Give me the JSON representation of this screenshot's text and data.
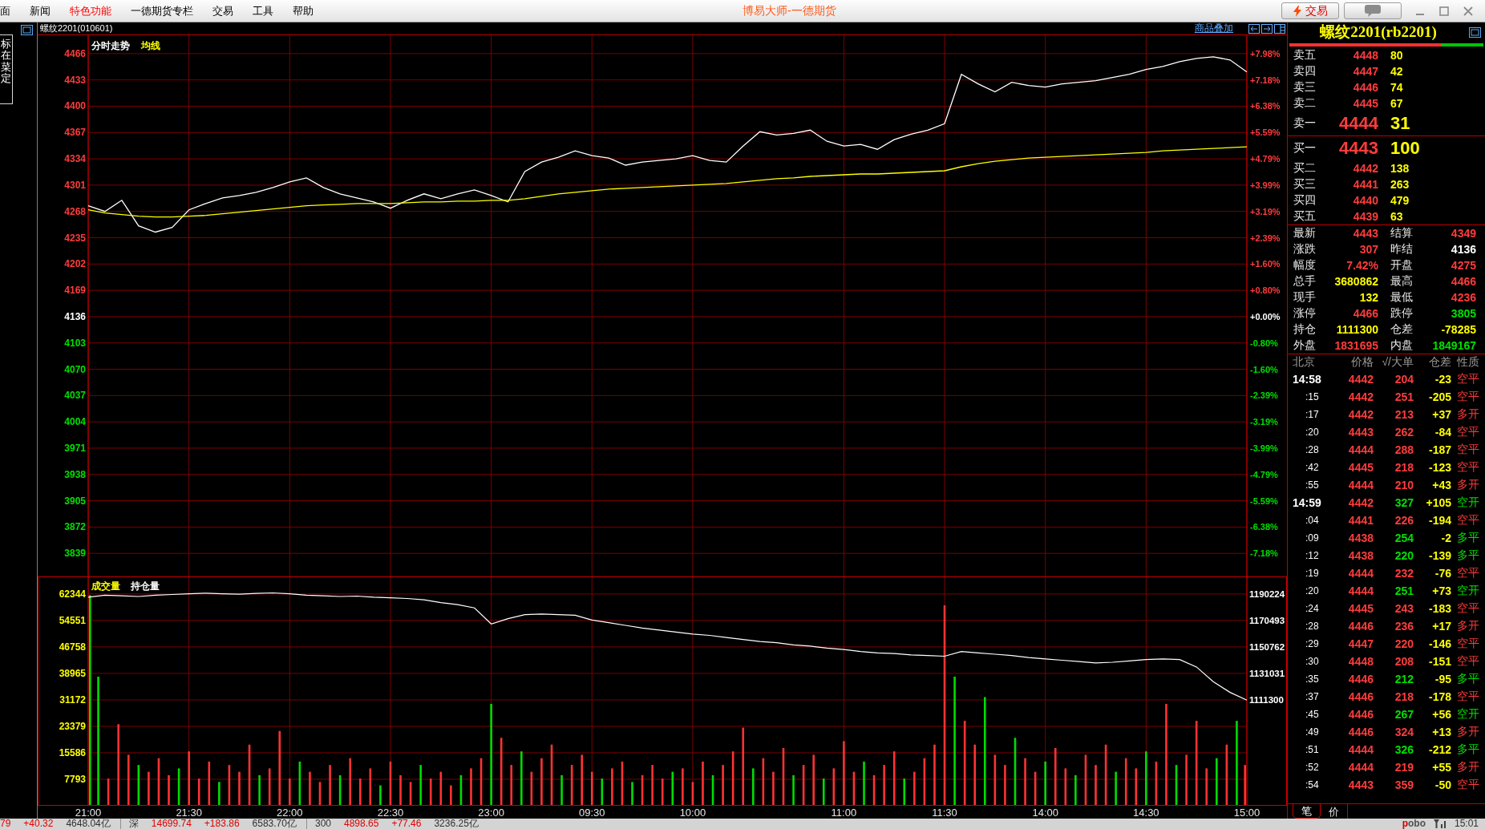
{
  "menu_bar": {
    "items": [
      {
        "label": "面",
        "highlighted": false
      },
      {
        "label": "新闻",
        "highlighted": false
      },
      {
        "label": "特色功能",
        "highlighted": true
      },
      {
        "label": "一德期货专栏",
        "highlighted": false
      },
      {
        "label": "交易",
        "highlighted": false
      },
      {
        "label": "工具",
        "highlighted": false
      },
      {
        "label": "帮助",
        "highlighted": false
      }
    ],
    "title": "博易大师-一德期货",
    "trade_button": {
      "label": "交易"
    }
  },
  "side_tab": {
    "label": "标在菜定"
  },
  "chart_header": {
    "symbol": "螺纹2201(010601)",
    "overlay_link": "商品叠加"
  },
  "price_chart": {
    "percent_axis": [
      {
        "label": "+7.98%",
        "color": "#ff3c3c"
      },
      {
        "label": "+7.18%",
        "color": "#ff3c3c"
      },
      {
        "label": "+6.38%",
        "color": "#ff3c3c"
      },
      {
        "label": "+5.59%",
        "color": "#ff3c3c"
      },
      {
        "label": "+4.79%",
        "color": "#ff3c3c"
      },
      {
        "label": "+3.99%",
        "color": "#ff3c3c"
      },
      {
        "label": "+3.19%",
        "color": "#ff3c3c"
      },
      {
        "label": "+2.39%",
        "color": "#ff3c3c"
      },
      {
        "label": "+1.60%",
        "color": "#ff3c3c"
      },
      {
        "label": "+0.80%",
        "color": "#ff3c3c"
      },
      {
        "label": "+0.00%",
        "color": "#ffffff"
      },
      {
        "label": "-0.80%",
        "color": "#00e000"
      },
      {
        "label": "-1.60%",
        "color": "#00e000"
      },
      {
        "label": "-2.39%",
        "color": "#00e000"
      },
      {
        "label": "-3.19%",
        "color": "#00e000"
      },
      {
        "label": "-3.99%",
        "color": "#00e000"
      },
      {
        "label": "-4.79%",
        "color": "#00e000"
      },
      {
        "label": "-5.59%",
        "color": "#00e000"
      },
      {
        "label": "-6.38%",
        "color": "#00e000"
      },
      {
        "label": "-7.18%",
        "color": "#00e000"
      }
    ],
    "chart_data": {
      "type": "line",
      "categories": [
        null,
        null,
        null,
        null,
        null,
        null,
        null,
        null,
        null,
        null,
        null,
        null,
        null,
        null,
        null,
        null,
        null,
        null,
        null,
        null,
        null,
        null,
        null,
        null,
        null,
        null,
        null,
        null,
        null,
        null,
        null,
        null,
        null,
        null,
        null,
        null,
        null,
        null,
        null,
        null,
        null,
        null,
        null,
        null,
        null,
        null,
        null,
        null,
        null,
        null,
        null,
        null,
        null,
        null,
        null,
        null,
        null,
        null,
        null,
        null,
        null,
        null,
        null,
        null,
        null,
        null,
        null,
        null,
        null,
        null
      ],
      "series": [
        {
          "name": "分时走势",
          "color": "#ffffff",
          "values": [
            4275,
            4268,
            4282,
            4250,
            4242,
            4248,
            4270,
            4278,
            4285,
            4288,
            4292,
            4298,
            4305,
            4310,
            4298,
            4290,
            4285,
            4280,
            4272,
            4282,
            4290,
            4284,
            4290,
            4295,
            4288,
            4280,
            4318,
            4330,
            4336,
            4344,
            4338,
            4335,
            4326,
            4330,
            4332,
            4334,
            4338,
            4332,
            4330,
            4350,
            4368,
            4364,
            4366,
            4370,
            4356,
            4350,
            4352,
            4346,
            4358,
            4365,
            4370,
            4378,
            4440,
            4428,
            4418,
            4430,
            4426,
            4424,
            4428,
            4430,
            4432,
            4436,
            4440,
            4446,
            4450,
            4456,
            4460,
            4462,
            4458,
            4443
          ]
        },
        {
          "name": "均线",
          "color": "#ffff00",
          "values": [
            4270,
            4266,
            4264,
            4262,
            4261,
            4261,
            4262,
            4263,
            4265,
            4267,
            4269,
            4271,
            4273,
            4275,
            4276,
            4277,
            4278,
            4278,
            4278,
            4279,
            4280,
            4280,
            4281,
            4281,
            4282,
            4282,
            4284,
            4287,
            4290,
            4292,
            4294,
            4296,
            4297,
            4298,
            4299,
            4300,
            4301,
            4302,
            4303,
            4305,
            4307,
            4309,
            4310,
            4312,
            4313,
            4314,
            4315,
            4315,
            4316,
            4317,
            4318,
            4319,
            4324,
            4328,
            4331,
            4333,
            4335,
            4336,
            4337,
            4338,
            4339,
            4340,
            4341,
            4342,
            4344,
            4345,
            4346,
            4347,
            4348,
            4349
          ]
        }
      ],
      "ylim": [
        3810,
        4489
      ],
      "yticks": [
        4466,
        4433,
        4400,
        4367,
        4334,
        4301,
        4268,
        4235,
        4202,
        4169,
        4136,
        4103,
        4070,
        4037,
        4004,
        3971,
        3938,
        3905,
        3872,
        3839
      ],
      "grid": true
    }
  },
  "volume_chart": {
    "legend": [
      {
        "label": "成交量",
        "color": "#ffff00"
      }
    ],
    "chart_data": {
      "type": "bar",
      "categories": [
        "21:00",
        null,
        null,
        null,
        null,
        null,
        null,
        null,
        null,
        null,
        "21:30",
        null,
        null,
        null,
        null,
        null,
        null,
        null,
        null,
        null,
        "22:00",
        null,
        null,
        null,
        null,
        null,
        null,
        null,
        null,
        null,
        "22:30",
        null,
        null,
        null,
        null,
        null,
        null,
        null,
        null,
        null,
        "23:00",
        null,
        null,
        null,
        null,
        null,
        null,
        null,
        null,
        null,
        "09:30",
        null,
        null,
        null,
        null,
        null,
        null,
        null,
        null,
        null,
        "10:00",
        null,
        null,
        null,
        null,
        null,
        null,
        null,
        null,
        null,
        null,
        null,
        null,
        null,
        null,
        "11:00",
        null,
        null,
        null,
        null,
        null,
        null,
        null,
        null,
        null,
        "11:30",
        null,
        null,
        null,
        null,
        null,
        null,
        null,
        null,
        null,
        "14:00",
        null,
        null,
        null,
        null,
        null,
        null,
        null,
        null,
        null,
        "14:30",
        null,
        null,
        null,
        null,
        null,
        null,
        null,
        null,
        null,
        "15:00"
      ],
      "series": [
        {
          "color": "#ff3232",
          "values": [
            null,
            null,
            8000,
            24000,
            15000,
            null,
            10000,
            14000,
            9000,
            null,
            16000,
            8000,
            13000,
            null,
            12000,
            10000,
            18000,
            null,
            11000,
            22000,
            8000,
            null,
            10000,
            7000,
            12000,
            null,
            14000,
            8000,
            11000,
            null,
            13000,
            9000,
            7000,
            null,
            8000,
            10000,
            6000,
            null,
            11000,
            14000,
            null,
            20000,
            12000,
            null,
            10000,
            14000,
            18000,
            null,
            12000,
            15000,
            10000,
            null,
            11000,
            13000,
            null,
            9000,
            12000,
            8000,
            null,
            11000,
            7000,
            13000,
            null,
            12000,
            16000,
            23000,
            null,
            14000,
            10000,
            17000,
            null,
            12000,
            15000,
            null,
            11000,
            19000,
            10000,
            null,
            9000,
            12000,
            16000,
            null,
            10000,
            14000,
            18000,
            59000,
            null,
            25000,
            18000,
            null,
            15000,
            12000,
            null,
            14000,
            10000,
            null,
            17000,
            11000,
            null,
            15000,
            12000,
            18000,
            null,
            14000,
            11000,
            null,
            13000,
            30000,
            null,
            15000,
            25000,
            11000,
            null,
            18000,
            null,
            12000
          ]
        },
        {
          "color": "#00dc00",
          "values": [
            62000,
            38000,
            null,
            null,
            null,
            12000,
            null,
            null,
            null,
            11000,
            null,
            null,
            null,
            7000,
            null,
            null,
            null,
            9000,
            null,
            null,
            null,
            13000,
            null,
            null,
            null,
            9000,
            null,
            null,
            null,
            6000,
            null,
            null,
            null,
            12000,
            null,
            null,
            null,
            9000,
            null,
            null,
            30000,
            null,
            null,
            16000,
            null,
            null,
            null,
            9000,
            null,
            null,
            null,
            8000,
            null,
            null,
            7000,
            null,
            null,
            null,
            10000,
            null,
            null,
            null,
            9000,
            null,
            null,
            null,
            11000,
            null,
            null,
            null,
            9000,
            null,
            null,
            8000,
            null,
            null,
            null,
            13000,
            null,
            null,
            null,
            8000,
            null,
            null,
            null,
            null,
            38000,
            null,
            null,
            32000,
            null,
            null,
            20000,
            null,
            null,
            13000,
            null,
            null,
            9000,
            null,
            null,
            null,
            10000,
            null,
            null,
            16000,
            null,
            null,
            12000,
            null,
            null,
            null,
            14000,
            null,
            25000,
            null
          ]
        }
      ],
      "ylim": [
        0,
        67500
      ],
      "yticks": [
        62344,
        54551,
        46758,
        38965,
        31172,
        23379,
        15586,
        7793
      ],
      "grid": true
    }
  },
  "open_interest_chart": {
    "chart_data": {
      "type": "line",
      "categories": [
        null,
        null,
        null,
        null,
        null,
        null,
        null,
        null,
        null,
        null,
        null,
        null,
        null,
        null,
        null,
        null,
        null,
        null,
        null,
        null,
        null,
        null,
        null,
        null,
        null,
        null,
        null,
        null,
        null,
        null,
        null,
        null,
        null,
        null,
        null,
        null,
        null,
        null,
        null,
        null,
        null,
        null,
        null,
        null,
        null,
        null,
        null,
        null,
        null,
        null,
        null,
        null,
        null,
        null,
        null,
        null,
        null,
        null,
        null,
        null,
        null,
        null,
        null,
        null,
        null,
        null,
        null,
        null,
        null,
        null
      ],
      "series": [
        {
          "name": "持仓量",
          "color": "#ffffff",
          "values": [
            1188000,
            1189500,
            1189000,
            1188500,
            1189500,
            1190000,
            1190500,
            1191000,
            1190500,
            1190200,
            1190800,
            1191200,
            1190500,
            1189500,
            1189000,
            1188500,
            1188800,
            1188000,
            1187500,
            1187000,
            1186000,
            1184000,
            1182500,
            1180000,
            1168000,
            1172000,
            1175000,
            1175500,
            1175000,
            1174500,
            1171000,
            1169000,
            1167000,
            1165000,
            1163500,
            1162000,
            1160500,
            1159500,
            1158000,
            1156500,
            1155000,
            1154000,
            1152500,
            1151500,
            1150000,
            1149000,
            1147500,
            1146500,
            1146000,
            1145000,
            1144500,
            1144000,
            1147500,
            1146500,
            1145500,
            1144500,
            1143000,
            1142000,
            1141000,
            1140000,
            1139000,
            1139500,
            1140500,
            1141500,
            1142000,
            1141500,
            1136000,
            1125000,
            1117000,
            1111300
          ]
        }
      ],
      "ylim": [
        1032500,
        1203460
      ],
      "yticks": [
        1190224,
        1170493,
        1150762,
        1131031,
        1111300
      ]
    }
  },
  "quote_panel": {
    "title": "螺纹2201(rb2201)",
    "ratio_bar": {
      "level": 0.78
    },
    "asks": [
      {
        "label": "卖五",
        "price": "4448",
        "volume": "80",
        "kind": "level"
      },
      {
        "label": "卖四",
        "price": "4447",
        "volume": "42",
        "kind": "level"
      },
      {
        "label": "卖三",
        "price": "4446",
        "volume": "74",
        "kind": "level"
      },
      {
        "label": "卖二",
        "price": "4445",
        "volume": "67",
        "kind": "level"
      },
      {
        "label": "卖一",
        "price": "4444",
        "volume": "31",
        "kind": "best"
      }
    ],
    "bids": [
      {
        "label": "买一",
        "price": "4443",
        "volume": "100",
        "kind": "best"
      },
      {
        "label": "买二",
        "price": "4442",
        "volume": "138",
        "kind": "level"
      },
      {
        "label": "买三",
        "price": "4441",
        "volume": "263",
        "kind": "level"
      },
      {
        "label": "买四",
        "price": "4440",
        "volume": "479",
        "kind": "level"
      },
      {
        "label": "买五",
        "price": "4439",
        "volume": "63",
        "kind": "level"
      }
    ],
    "stats": [
      {
        "label": "最新",
        "value": "4443",
        "color": "#ff3c3c"
      },
      {
        "label": "结算",
        "value": "4349",
        "color": "#ff3c3c"
      },
      {
        "label": "涨跌",
        "value": "307",
        "color": "#ff3c3c"
      },
      {
        "label": "昨结",
        "value": "4136",
        "color": "#ffffff"
      },
      {
        "label": "幅度",
        "value": "7.42%",
        "color": "#ff3c3c"
      },
      {
        "label": "开盘",
        "value": "4275",
        "color": "#ff3c3c"
      },
      {
        "label": "总手",
        "value": "3680862",
        "color": "#ffff00"
      },
      {
        "label": "最高",
        "value": "4466",
        "color": "#ff3c3c"
      },
      {
        "label": "现手",
        "value": "132",
        "color": "#ffff00"
      },
      {
        "label": "最低",
        "value": "4236",
        "color": "#ff3c3c"
      },
      {
        "label": "涨停",
        "value": "4466",
        "color": "#ff3c3c"
      },
      {
        "label": "跌停",
        "value": "3805",
        "color": "#00e000"
      },
      {
        "label": "持仓",
        "value": "1111300",
        "color": "#ffff00"
      },
      {
        "label": "仓差",
        "value": "-78285",
        "color": "#ffff00"
      },
      {
        "label": "外盘",
        "value": "1831695",
        "color": "#ff3c3c"
      },
      {
        "label": "内盘",
        "value": "1849167",
        "color": "#00e000"
      }
    ],
    "ticks": {
      "columns": [
        "北京",
        "价格",
        "√/大单",
        "仓差",
        "性质"
      ],
      "rows": [
        {
          "time": "14:58",
          "kind": "minute",
          "price": "4442",
          "volume": "204",
          "oi_change": "-23",
          "nature": "空平",
          "color": "#ff3c3c"
        },
        {
          "time": ":15",
          "kind": "second",
          "price": "4442",
          "volume": "251",
          "oi_change": "-205",
          "nature": "空平",
          "color": "#ff3c3c"
        },
        {
          "time": ":17",
          "kind": "second",
          "price": "4442",
          "volume": "213",
          "oi_change": "+37",
          "nature": "多开",
          "color": "#ff3c3c"
        },
        {
          "time": ":20",
          "kind": "second",
          "price": "4443",
          "volume": "262",
          "oi_change": "-84",
          "nature": "空平",
          "color": "#ff3c3c"
        },
        {
          "time": ":28",
          "kind": "second",
          "price": "4444",
          "volume": "288",
          "oi_change": "-187",
          "nature": "空平",
          "color": "#ff3c3c"
        },
        {
          "time": ":42",
          "kind": "second",
          "price": "4445",
          "volume": "218",
          "oi_change": "-123",
          "nature": "空平",
          "color": "#ff3c3c"
        },
        {
          "time": ":55",
          "kind": "second",
          "price": "4444",
          "volume": "210",
          "oi_change": "+43",
          "nature": "多开",
          "color": "#ff3c3c"
        },
        {
          "time": "14:59",
          "kind": "minute",
          "price": "4442",
          "volume": "327",
          "oi_change": "+105",
          "nature": "空开",
          "color": "#00e000"
        },
        {
          "time": ":04",
          "kind": "second",
          "price": "4441",
          "volume": "226",
          "oi_change": "-194",
          "nature": "空平",
          "color": "#ff3c3c"
        },
        {
          "time": ":09",
          "kind": "second",
          "price": "4438",
          "volume": "254",
          "oi_change": "-2",
          "nature": "多平",
          "color": "#00e000"
        },
        {
          "time": ":12",
          "kind": "second",
          "price": "4438",
          "volume": "220",
          "oi_change": "-139",
          "nature": "多平",
          "color": "#00e000"
        },
        {
          "time": ":19",
          "kind": "second",
          "price": "4444",
          "volume": "232",
          "oi_change": "-76",
          "nature": "空平",
          "color": "#ff3c3c"
        },
        {
          "time": ":20",
          "kind": "second",
          "price": "4444",
          "volume": "251",
          "oi_change": "+73",
          "nature": "空开",
          "color": "#00e000"
        },
        {
          "time": ":24",
          "kind": "second",
          "price": "4445",
          "volume": "243",
          "oi_change": "-183",
          "nature": "空平",
          "color": "#ff3c3c"
        },
        {
          "time": ":28",
          "kind": "second",
          "price": "4446",
          "volume": "236",
          "oi_change": "+17",
          "nature": "多开",
          "color": "#ff3c3c"
        },
        {
          "time": ":29",
          "kind": "second",
          "price": "4447",
          "volume": "220",
          "oi_change": "-146",
          "nature": "空平",
          "color": "#ff3c3c"
        },
        {
          "time": ":30",
          "kind": "second",
          "price": "4448",
          "volume": "208",
          "oi_change": "-151",
          "nature": "空平",
          "color": "#ff3c3c"
        },
        {
          "time": ":35",
          "kind": "second",
          "price": "4446",
          "volume": "212",
          "oi_change": "-95",
          "nature": "多平",
          "color": "#00e000"
        },
        {
          "time": ":37",
          "kind": "second",
          "price": "4446",
          "volume": "218",
          "oi_change": "-178",
          "nature": "空平",
          "color": "#ff3c3c"
        },
        {
          "time": ":45",
          "kind": "second",
          "price": "4446",
          "volume": "267",
          "oi_change": "+56",
          "nature": "空开",
          "color": "#00e000"
        },
        {
          "time": ":49",
          "kind": "second",
          "price": "4446",
          "volume": "324",
          "oi_change": "+13",
          "nature": "多开",
          "color": "#ff3c3c"
        },
        {
          "time": ":51",
          "kind": "second",
          "price": "4444",
          "volume": "326",
          "oi_change": "-212",
          "nature": "多平",
          "color": "#00e000"
        },
        {
          "time": ":52",
          "kind": "second",
          "price": "4444",
          "volume": "219",
          "oi_change": "+55",
          "nature": "多开",
          "color": "#ff3c3c"
        },
        {
          "time": ":54",
          "kind": "second",
          "price": "4443",
          "volume": "359",
          "oi_change": "-50",
          "nature": "空平",
          "color": "#ff3c3c"
        }
      ]
    },
    "tabs": [
      {
        "label": "笔",
        "selected": true
      },
      {
        "label": "价",
        "selected": false
      }
    ]
  },
  "status_bar": {
    "indices": [
      {
        "price": "79",
        "change": "+40.32",
        "amount": "4648.04亿"
      },
      {
        "name": "深",
        "price": "14699.74",
        "change": "+183.86",
        "amount": "6583.70亿"
      },
      {
        "name": "300",
        "price": "4898.65",
        "change": "+77.46",
        "amount": "3236.25亿"
      }
    ],
    "brand": "pobo",
    "time": "15:01"
  }
}
